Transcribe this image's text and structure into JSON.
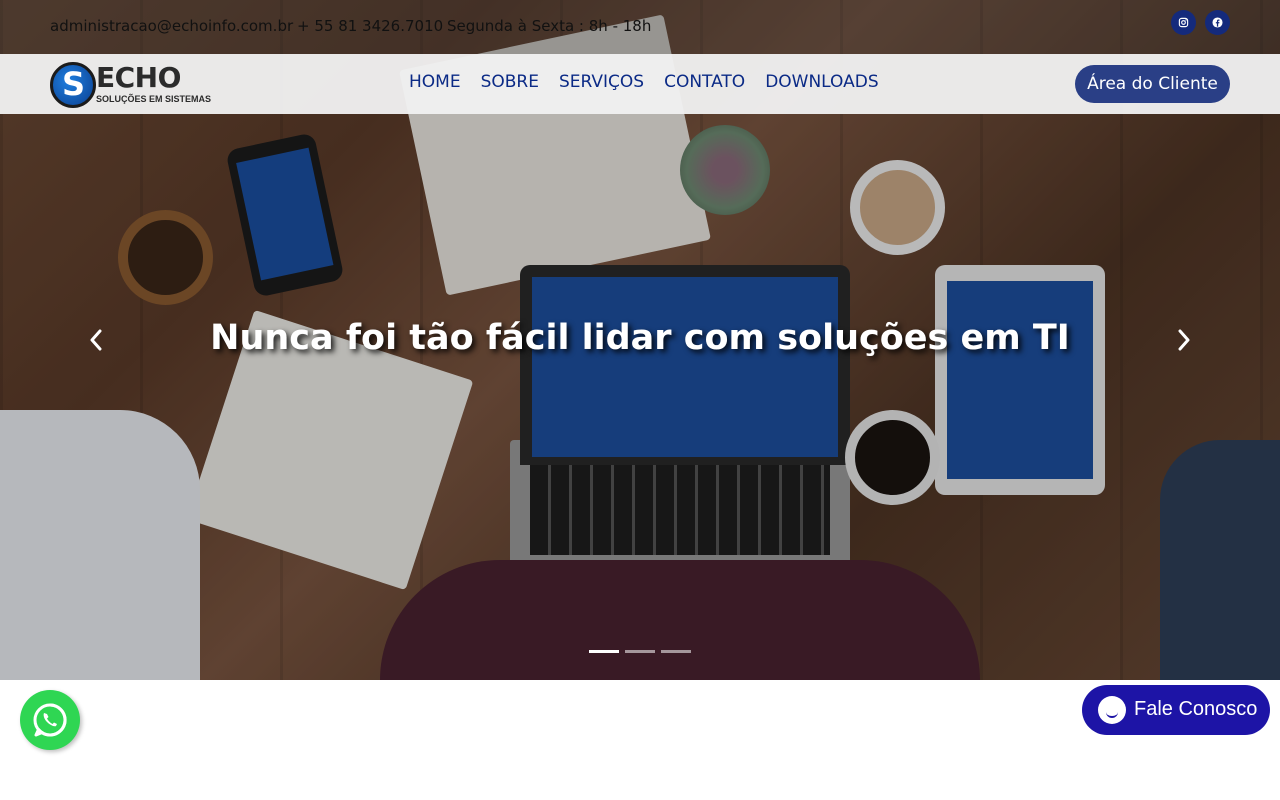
{
  "topbar": {
    "email": "administracao@echoinfo.com.br",
    "phone": "+ 55 81 3426.7010",
    "hours": "Segunda à Sexta : 8h - 18h",
    "social": [
      {
        "icon": "instagram-icon"
      },
      {
        "icon": "facebook-icon"
      }
    ]
  },
  "header": {
    "logo_text": "ECHO",
    "logo_tagline": "SOLUÇÕES EM SISTEMAS",
    "nav": [
      "HOME",
      "SOBRE",
      "SERVIÇOS",
      "CONTATO",
      "DOWNLOADS"
    ],
    "client_button": "Área do Cliente"
  },
  "hero": {
    "headline": "Nunca foi tão fácil lidar com soluções em TI",
    "prev_icon": "chevron-left-icon",
    "next_icon": "chevron-right-icon",
    "slide_count": 3,
    "active_slide": 1
  },
  "widgets": {
    "whatsapp_icon": "whatsapp-icon",
    "chat_label": "Fale Conosco"
  },
  "colors": {
    "brand_blue": "#0b2a86",
    "button_blue": "#2a3f86",
    "social_blue": "#142a7c",
    "whatsapp_green": "#2fd653",
    "chat_blue": "#1d14a6"
  }
}
